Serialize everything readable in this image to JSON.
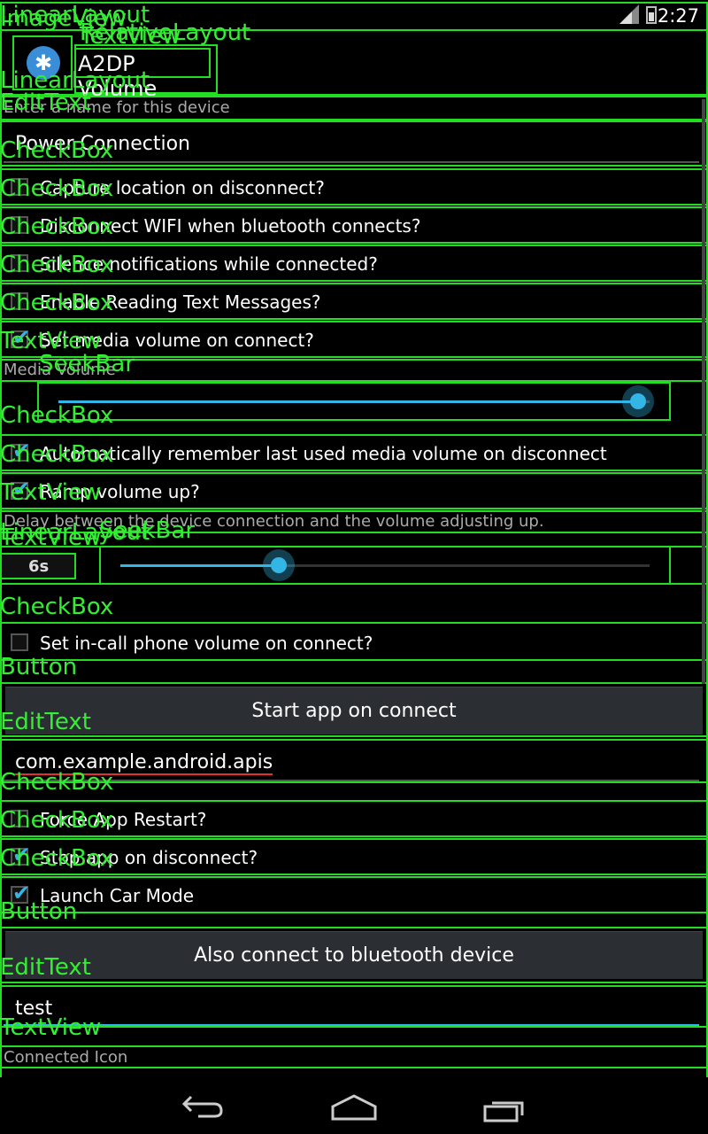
{
  "status_bar": {
    "network": "4G",
    "time": "2:27"
  },
  "header": {
    "title": "A2DP Volume",
    "icon": "bluetooth-icon"
  },
  "device_name": {
    "label": "Enter a name for this device",
    "value": "Power Connection"
  },
  "checkboxes": [
    {
      "label": "Capture location on disconnect?",
      "checked": false
    },
    {
      "label": "Disconnect WIFI when bluetooth connects?",
      "checked": false
    },
    {
      "label": "Silence notifications while connected?",
      "checked": false
    },
    {
      "label": "Enable Reading Text Messages?",
      "checked": false
    },
    {
      "label": "Set media volume on connect?",
      "checked": true
    }
  ],
  "media_volume": {
    "label": "Media Volume",
    "level": 0.98
  },
  "checkboxes2": [
    {
      "label": "Automatically remember last used media volume on disconnect",
      "checked": true
    },
    {
      "label": "Ramp volume up?",
      "checked": true
    }
  ],
  "ramp": {
    "description": "Delay between the device connection and the volume adjusting up.",
    "value_text": "6s",
    "level": 0.3
  },
  "incall": {
    "label": "Set in-call phone volume on connect?",
    "checked": false
  },
  "start_app_button": "Start app on connect",
  "app_package": "com.example.android.apis",
  "checkboxes3": [
    {
      "label": "Force App Restart?",
      "checked": false
    },
    {
      "label": "Stop app on disconnect?",
      "checked": true
    },
    {
      "label": "Launch Car Mode",
      "checked": true
    }
  ],
  "bt_button": "Also connect to bluetooth device",
  "bt_device": "test",
  "connected_icon_label": "Connected Icon",
  "overlay_tags": {
    "t1": "LinearLayout",
    "t2": "ImageView",
    "t3": "TextView",
    "t4": "EditText",
    "t5": "CheckBox",
    "t6": "SeekBar",
    "t7": "Button",
    "t8": "RelativeLayout"
  },
  "nav": {
    "back": "back-icon",
    "home": "home-icon",
    "recents": "recents-icon"
  },
  "colors": {
    "accent": "#33b5e5",
    "overlay": "#22dd22",
    "background": "#000000"
  }
}
